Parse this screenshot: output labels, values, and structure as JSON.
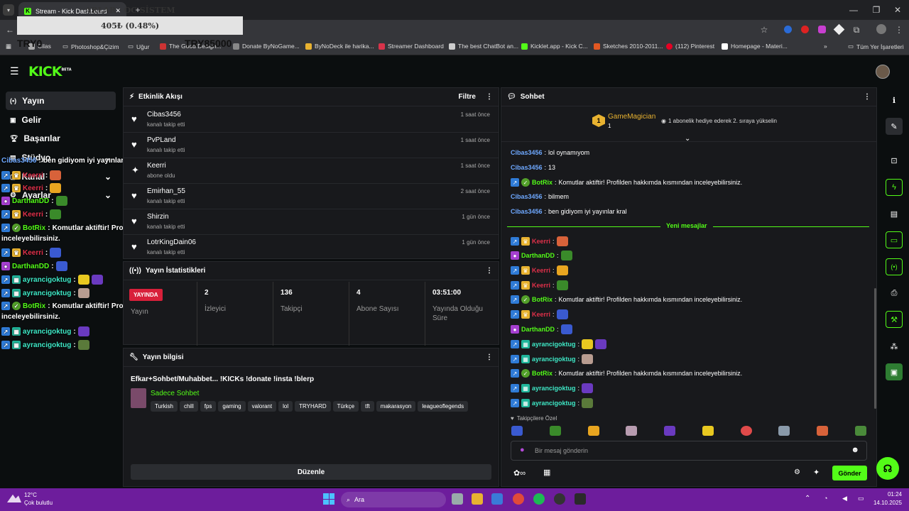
{
  "browser": {
    "tab_title": "Stream - Kick Dashboard",
    "bookmarks": [
      "Cilas",
      "Photoshop&Çizim",
      "Uğur",
      "The Good Design...",
      "Donate ByNoGame...",
      "ByNoDeck ile harika...",
      "Streamer Dashboard",
      "The best ChatBot an...",
      "Kicklet.app - Kick C...",
      "Sketches 2010-2011...",
      "(112) Pinterest",
      "Homepage - Materi..."
    ],
    "all_bookmarks": "Tüm Yer İşaretleri"
  },
  "overlay": {
    "title": "ARLAR · OC SİSTEM",
    "progress_text": "405₺ (0.48%)",
    "left_amount": "TRY0",
    "right_amount": "TRY85000"
  },
  "app": {
    "logo": "KICK",
    "logo_sup": "BETA"
  },
  "sidebar": {
    "items": [
      {
        "label": "Yayın"
      },
      {
        "label": "Gelir"
      },
      {
        "label": "Başarılar"
      },
      {
        "label": "Stüdyo"
      },
      {
        "label": "Kanal"
      },
      {
        "label": "Ayarlar"
      }
    ]
  },
  "activity": {
    "title": "Etkinlik Akışı",
    "filter": "Filtre",
    "events": [
      {
        "name": "Cibas3456",
        "action": "kanalı takip etti",
        "time": "1 saat önce"
      },
      {
        "name": "PvPLand",
        "action": "kanalı takip etti",
        "time": "1 saat önce"
      },
      {
        "name": "Keerri",
        "action": "abone oldu",
        "time": "1 saat önce"
      },
      {
        "name": "Emirhan_55",
        "action": "kanalı takip etti",
        "time": "2 saat önce"
      },
      {
        "name": "Shirzin",
        "action": "kanalı takip etti",
        "time": "1 gün önce"
      },
      {
        "name": "LotrKingDain06",
        "action": "kanalı takip etti",
        "time": "1 gün önce"
      }
    ]
  },
  "stats": {
    "title": "Yayın İstatistikleri",
    "live_badge": "YAYINDA",
    "live_label": "Yayın",
    "items": [
      {
        "value": "2",
        "label": "İzleyici"
      },
      {
        "value": "136",
        "label": "Takipçi"
      },
      {
        "value": "4",
        "label": "Abone Sayısı"
      },
      {
        "value": "03:51:00",
        "label": "Yayında Olduğu Süre"
      }
    ]
  },
  "info": {
    "title": "Yayın bilgisi",
    "stream_title": "Efkar+Sohbet/Muhabbet... !KICKs !donate !insta !blerp",
    "category": "Sadece Sohbet",
    "tags": [
      "Turkish",
      "chill",
      "fps",
      "gaming",
      "valorant",
      "lol",
      "TRYHARD",
      "Türkçe",
      "tft",
      "makarasyon",
      "leagueoflegends"
    ],
    "edit_button": "Düzenle"
  },
  "chat": {
    "title": "Sohbet",
    "pinned_user": "GameMagician",
    "pinned_rank": "1",
    "pinned_count": "1",
    "pinned_text": "1 abonelik hediye ederek 2. sıraya yükselin",
    "new_messages": "Yeni mesajlar",
    "followers_only": "Takipçilere Özel",
    "input_placeholder": "Bir mesaj gönderin",
    "send": "Gönder",
    "old_messages": [
      {
        "user": "Cibas3456",
        "text": "lol oynamıyom"
      },
      {
        "user": "Cibas3456",
        "text": "13"
      },
      {
        "user": "BotRix",
        "text": "Komutlar aktiftir! Profilden hakkımda kısmından inceleyebilirsiniz."
      },
      {
        "user": "Cibas3456",
        "text": "bilmem"
      },
      {
        "user": "Cibas3456",
        "text": "ben gidiyom iyi yayınlar kral"
      }
    ],
    "new_list": [
      {
        "user": "Keerri",
        "text": ""
      },
      {
        "user": "DarthanDD",
        "text": ""
      },
      {
        "user": "Keerri",
        "text": ""
      },
      {
        "user": "Keerri",
        "text": ""
      },
      {
        "user": "BotRix",
        "text": "Komutlar aktiftir! Profilden hakkımda kısmından inceleyebilirsiniz."
      },
      {
        "user": "Keerri",
        "text": ""
      },
      {
        "user": "DarthanDD",
        "text": ""
      },
      {
        "user": "ayrancigoktug",
        "text": ""
      },
      {
        "user": "ayrancigoktug",
        "text": ""
      },
      {
        "user": "BotRix",
        "text": "Komutlar aktiftir! Profilden hakkımda kısmından inceleyebilirsiniz."
      },
      {
        "user": "ayrancigoktug",
        "text": ""
      },
      {
        "user": "ayrancigoktug",
        "text": ""
      }
    ]
  },
  "overlay_chat": [
    {
      "user": "Cibas3456",
      "text": "ben gidiyom iyi yayınlar kral"
    },
    {
      "user": "Keerri",
      "text": ""
    },
    {
      "user": "Keerri",
      "text": ""
    },
    {
      "user": "DarthanDD",
      "text": ""
    },
    {
      "user": "Keerri",
      "text": ""
    },
    {
      "user": "BotRix",
      "text": "Komutlar aktiftir! Profilden hakkımda kısmından"
    },
    {
      "user": "",
      "text": "inceleyebilirsiniz."
    },
    {
      "user": "Keerri",
      "text": ""
    },
    {
      "user": "DarthanDD",
      "text": ""
    },
    {
      "user": "ayrancigoktug",
      "text": ""
    },
    {
      "user": "ayrancigoktug",
      "text": ""
    },
    {
      "user": "BotRix",
      "text": "Komutlar aktiftir! Profilden hakkımda kısmından"
    },
    {
      "user": "",
      "text": "inceleyebilirsiniz."
    },
    {
      "user": "ayrancigoktug",
      "text": ""
    },
    {
      "user": "ayrancigoktug",
      "text": ""
    }
  ],
  "taskbar": {
    "weather_temp": "12°C",
    "weather_text": "Çok bulutlu",
    "search": "Ara",
    "time": "01:24",
    "date": "14.10.2025"
  },
  "colors": {
    "kick_green": "#53fc18",
    "taskbar": "#6d1d9c",
    "keerri": "#e0304a",
    "cibas": "#6ea8ff",
    "botrix": "#53fc18",
    "ayran": "#3ee8c6",
    "darthan": "#53fc18"
  }
}
